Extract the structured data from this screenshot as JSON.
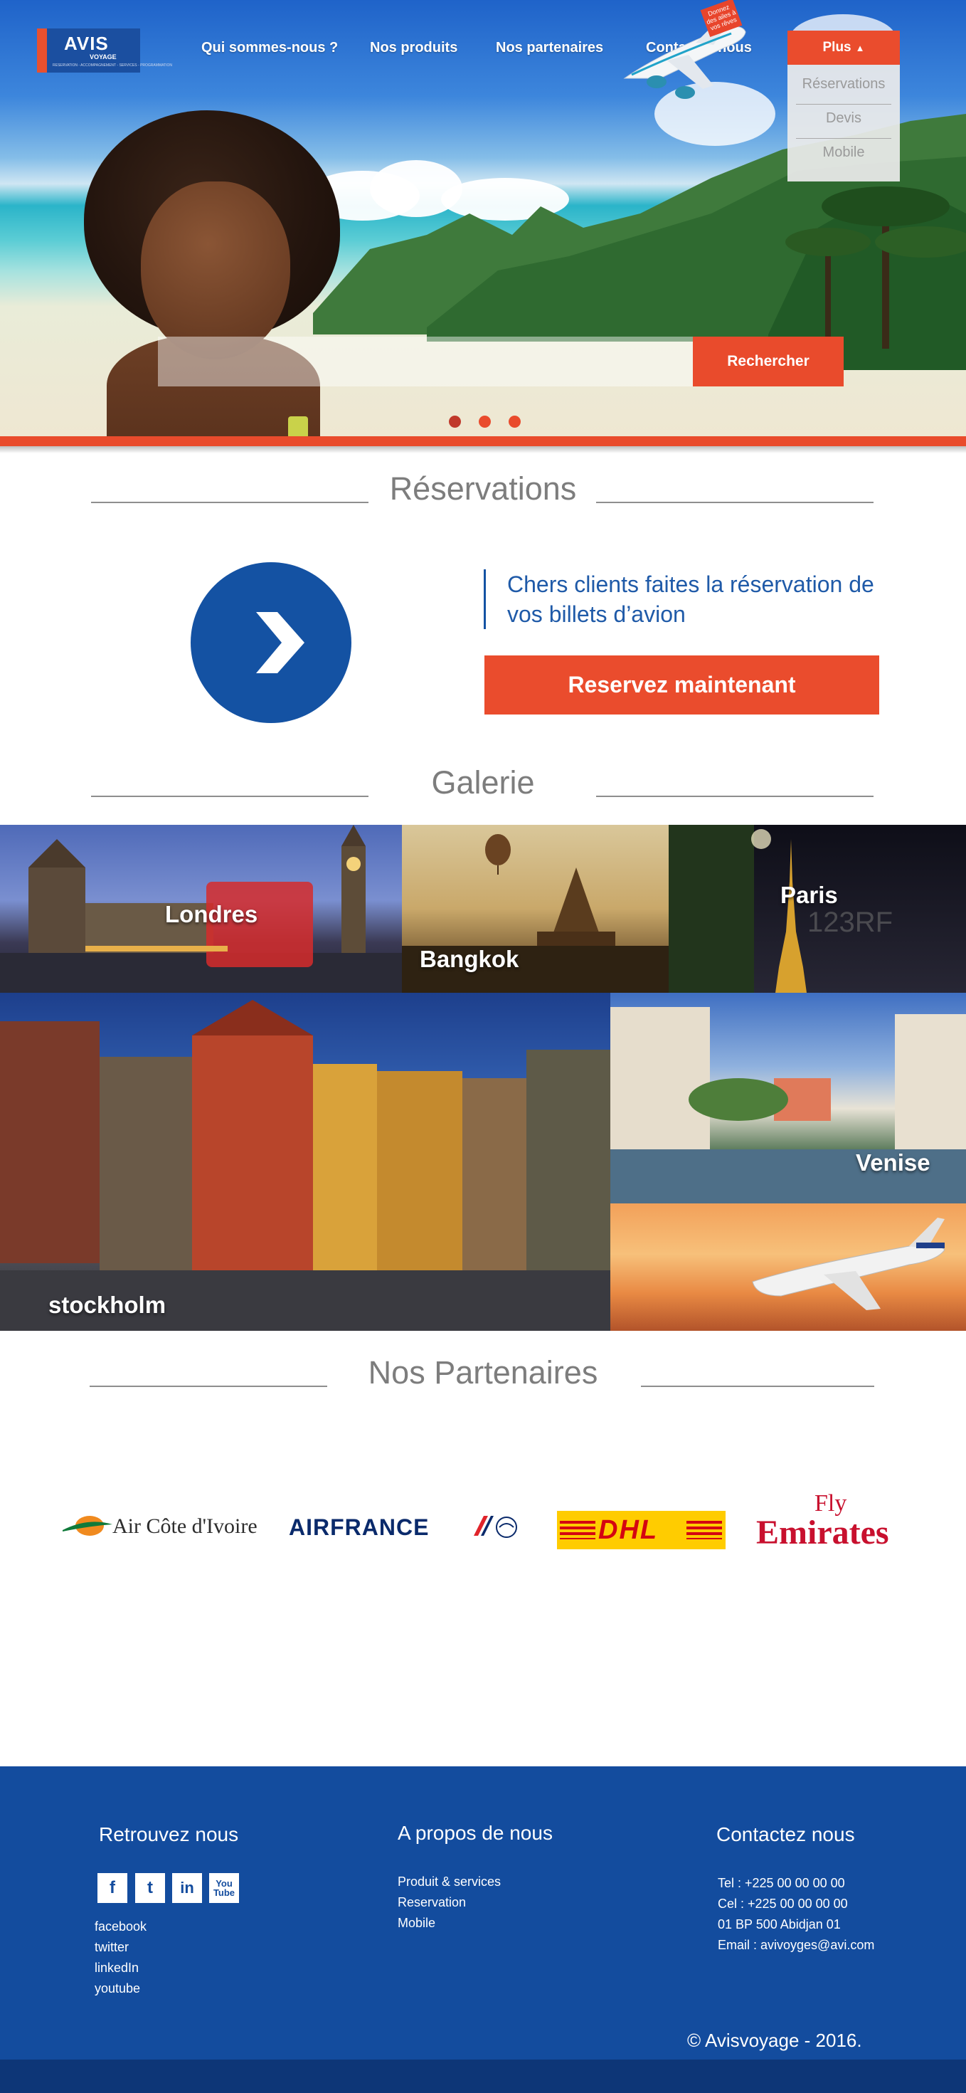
{
  "brand": {
    "name": "AVIS",
    "sub": "VOYAGE",
    "tagline": "RESERVATION - ACCOMPAGNEMENT - SERVICES - PROGRAMMATION"
  },
  "nav": {
    "items": [
      "Qui sommes-nous ?",
      "Nos produits",
      "Nos partenaires",
      "Contactez nous"
    ],
    "more_label": "Plus",
    "more_menu": [
      "Réservations",
      "Devis",
      "Mobile"
    ]
  },
  "hero": {
    "plane_tag": "Donnez des ailes à vos rêves",
    "search_value": "",
    "search_button": "Rechercher",
    "slides": 3,
    "active_slide": 1
  },
  "reservations": {
    "title": "Réservations",
    "message": "Chers clients faites la réservation de vos billets d’avion",
    "cta": "Reservez maintenant"
  },
  "gallery": {
    "title": "Galerie",
    "tiles": [
      {
        "label": "Londres"
      },
      {
        "label": "Bangkok"
      },
      {
        "label": "Paris"
      },
      {
        "label": "stockholm"
      },
      {
        "label": "Venise"
      },
      {
        "label": ""
      }
    ],
    "watermark": "123RF"
  },
  "partners": {
    "title": "Nos Partenaires",
    "items": [
      {
        "name": "Air Côte d'Ivoire"
      },
      {
        "name": "AIRFRANCE"
      },
      {
        "name": "DHL"
      },
      {
        "name_line1": "Fly",
        "name_line2": "Emirates"
      }
    ]
  },
  "footer": {
    "col1": {
      "title": "Retrouvez nous",
      "icons": [
        "facebook-icon",
        "twitter-icon",
        "linkedin-icon",
        "youtube-icon"
      ],
      "links": [
        "facebook",
        "twitter",
        "linkedIn",
        "youtube"
      ]
    },
    "col2": {
      "title": "A propos de nous",
      "links": [
        "Produit & services",
        "Reservation",
        "Mobile"
      ]
    },
    "col3": {
      "title": "Contactez nous",
      "lines": [
        "Tel : +225 00 00 00 00",
        "Cel : +225 00 00 00 00",
        "01 BP 500 Abidjan 01",
        "Email : avivoyges@avi.com"
      ]
    },
    "copyright": "© Avisvoyage - 2016."
  },
  "colors": {
    "accent": "#e94b2c",
    "primary": "#134c9e",
    "title_gray": "#7d7d7d"
  }
}
